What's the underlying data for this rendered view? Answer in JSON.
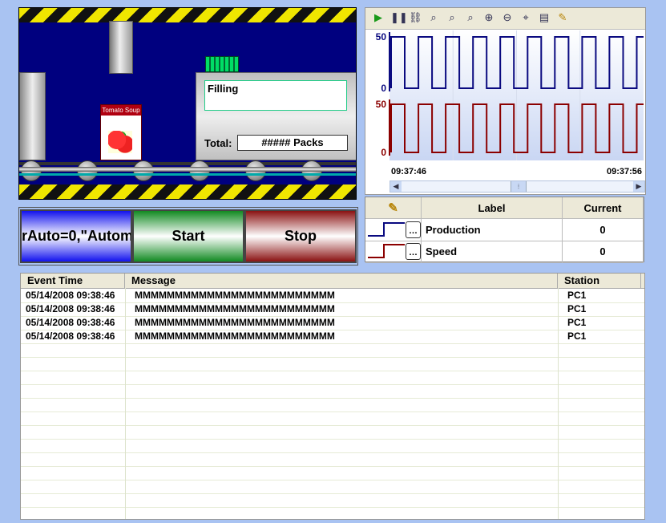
{
  "process": {
    "status_text": "Filling",
    "total_label": "Total:",
    "total_value": "##### Packs",
    "can_label": "Tomato Soup"
  },
  "buttons": {
    "mode_label": "rAuto=0,\"Autom",
    "start_label": "Start",
    "stop_label": "Stop"
  },
  "trend": {
    "time_start": "09:37:46",
    "time_end": "09:37:56",
    "toolbar_icons": [
      "play-icon",
      "pause-icon",
      "link-icon",
      "zoom-area-icon",
      "zoom-x-icon",
      "zoom-y-icon",
      "zoom-in-icon",
      "zoom-out-icon",
      "reset-zoom-icon",
      "legend-icon",
      "pen-icon"
    ]
  },
  "chart_data": {
    "type": "line",
    "x_range": [
      "09:37:46",
      "09:37:56"
    ],
    "series": [
      {
        "name": "Production",
        "color": "#0a0a80",
        "ylim": [
          0,
          50
        ],
        "ticks": [
          "50",
          "0"
        ],
        "low": 0,
        "high": 50,
        "cycles": 9
      },
      {
        "name": "Speed",
        "color": "#8b0000",
        "ylim": [
          0,
          50
        ],
        "ticks": [
          "50",
          "0"
        ],
        "low": 0,
        "high": 50,
        "cycles": 9
      }
    ]
  },
  "legend": {
    "headers": {
      "label": "Label",
      "current": "Current"
    },
    "rows": [
      {
        "label": "Production",
        "current": "0",
        "color": "#0a0a80"
      },
      {
        "label": "Speed",
        "current": "0",
        "color": "#8b0000"
      }
    ]
  },
  "grid": {
    "headers": {
      "time": "Event Time",
      "message": "Message",
      "station": "Station"
    },
    "rows": [
      {
        "time": "05/14/2008 09:38:46",
        "message": "MMMMMMMMMMMMMMMMMMMMMMMMM",
        "station": "PC1"
      },
      {
        "time": "05/14/2008 09:38:46",
        "message": "MMMMMMMMMMMMMMMMMMMMMMMMM",
        "station": "PC1"
      },
      {
        "time": "05/14/2008 09:38:46",
        "message": "MMMMMMMMMMMMMMMMMMMMMMMMM",
        "station": "PC1"
      },
      {
        "time": "05/14/2008 09:38:46",
        "message": "MMMMMMMMMMMMMMMMMMMMMMMMM",
        "station": "PC1"
      }
    ]
  }
}
